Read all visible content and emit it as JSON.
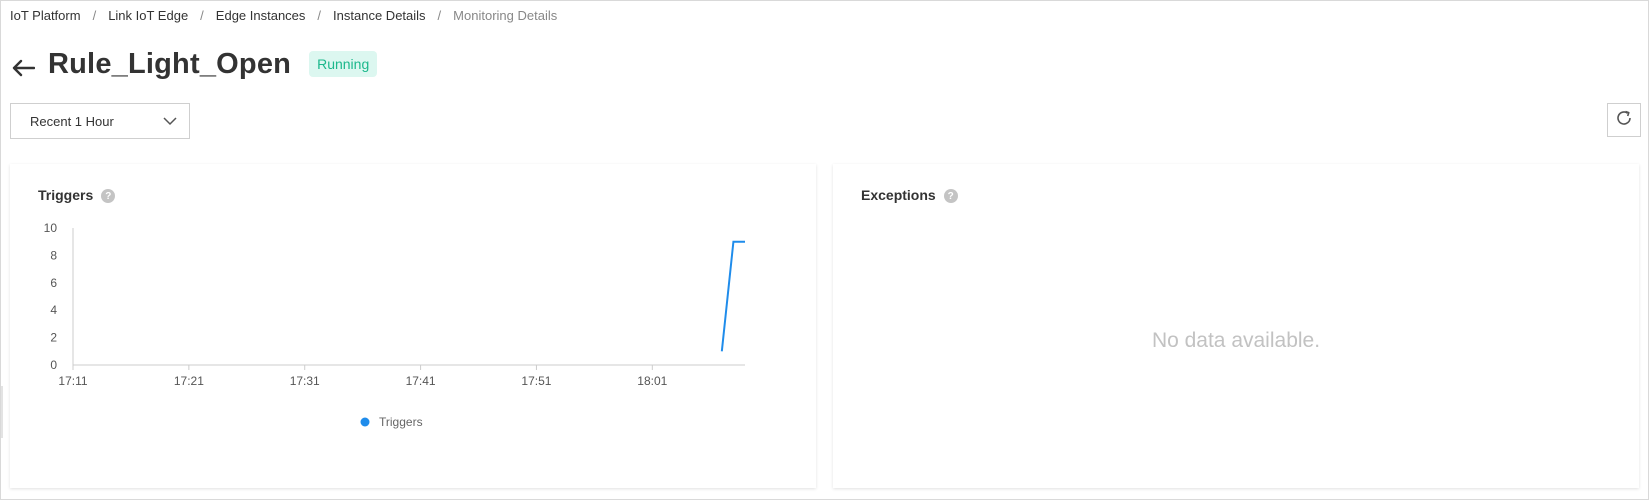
{
  "breadcrumb": [
    "IoT Platform",
    "Link IoT Edge",
    "Edge Instances",
    "Instance Details",
    "Monitoring Details"
  ],
  "breadcrumb_separator": "/",
  "header": {
    "title": "Rule_Light_Open",
    "status": "Running",
    "status_color": "#1cb88c"
  },
  "toolbar": {
    "time_range": "Recent 1 Hour",
    "refresh_icon": "refresh-icon"
  },
  "triggers_card": {
    "title": "Triggers",
    "help": "?"
  },
  "exceptions_card": {
    "title": "Exceptions",
    "help": "?",
    "empty_text": "No data available."
  },
  "chart_data": {
    "type": "line",
    "title": "Triggers",
    "x_ticks": [
      "17:11",
      "17:21",
      "17:31",
      "17:41",
      "17:51",
      "18:01"
    ],
    "y_ticks": [
      0,
      2,
      4,
      6,
      8,
      10
    ],
    "ylim": [
      0,
      10
    ],
    "xlim": [
      "17:11",
      "18:09"
    ],
    "series": [
      {
        "name": "Triggers",
        "color": "#1f8ceb",
        "points": [
          {
            "x": "18:07",
            "y": 1
          },
          {
            "x": "18:08",
            "y": 9
          },
          {
            "x": "18:09",
            "y": 9
          }
        ]
      }
    ],
    "legend": "bottom-center",
    "grid": false
  }
}
